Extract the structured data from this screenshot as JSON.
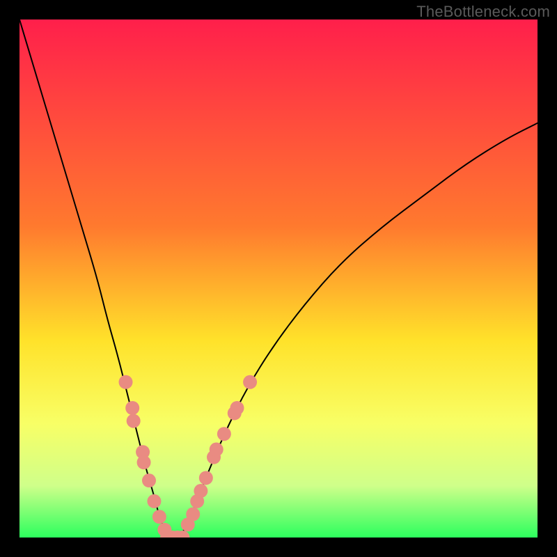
{
  "watermark": {
    "text": "TheBottleneck.com"
  },
  "chart_data": {
    "type": "line",
    "title": "",
    "xlabel": "",
    "ylabel": "",
    "xlim": [
      0,
      100
    ],
    "ylim": [
      0,
      100
    ],
    "grid": false,
    "legend": false,
    "background_gradient": {
      "stops": [
        {
          "offset": 0,
          "color": "#ff1f4b"
        },
        {
          "offset": 40,
          "color": "#ff7a2e"
        },
        {
          "offset": 62,
          "color": "#ffe22a"
        },
        {
          "offset": 78,
          "color": "#f8ff66"
        },
        {
          "offset": 90,
          "color": "#cfff8a"
        },
        {
          "offset": 100,
          "color": "#2cff5e"
        }
      ]
    },
    "series": [
      {
        "name": "left-curve",
        "x": [
          0,
          3,
          6,
          9,
          12,
          15,
          17,
          19,
          21,
          23,
          24.5,
          26,
          27,
          28,
          28.5
        ],
        "y": [
          100,
          90,
          80,
          70,
          60,
          50,
          42,
          35,
          27,
          19,
          13,
          8,
          4,
          1.5,
          0
        ],
        "color": "#000000",
        "stroke_width": 2
      },
      {
        "name": "right-curve",
        "x": [
          31,
          32,
          33.5,
          35,
          37,
          40,
          44,
          49,
          55,
          62,
          70,
          78,
          86,
          94,
          100
        ],
        "y": [
          0,
          2,
          5,
          9,
          14,
          21,
          29,
          37,
          45,
          53,
          60,
          66,
          72,
          77,
          80
        ],
        "color": "#000000",
        "stroke_width": 2
      }
    ],
    "marker_groups": [
      {
        "name": "left-markers",
        "color": "#e98b82",
        "radius": 10,
        "points": [
          {
            "x": 20.5,
            "y": 30
          },
          {
            "x": 21.8,
            "y": 25
          },
          {
            "x": 22.0,
            "y": 22.5
          },
          {
            "x": 23.8,
            "y": 16.5
          },
          {
            "x": 24.0,
            "y": 14.5
          },
          {
            "x": 25.0,
            "y": 11
          },
          {
            "x": 26.0,
            "y": 7
          },
          {
            "x": 27.0,
            "y": 4
          },
          {
            "x": 28.0,
            "y": 1.5
          }
        ]
      },
      {
        "name": "bottom-markers",
        "color": "#e98b82",
        "radius": 10,
        "points": [
          {
            "x": 28.5,
            "y": 0
          },
          {
            "x": 29.5,
            "y": 0
          },
          {
            "x": 30.5,
            "y": 0
          },
          {
            "x": 31.5,
            "y": 0
          }
        ]
      },
      {
        "name": "right-markers",
        "color": "#e98b82",
        "radius": 10,
        "points": [
          {
            "x": 32.5,
            "y": 2.5
          },
          {
            "x": 33.5,
            "y": 4.5
          },
          {
            "x": 34.3,
            "y": 7
          },
          {
            "x": 35.0,
            "y": 9
          },
          {
            "x": 36.0,
            "y": 11.5
          },
          {
            "x": 37.5,
            "y": 15.5
          },
          {
            "x": 38.0,
            "y": 17
          },
          {
            "x": 39.5,
            "y": 20
          },
          {
            "x": 41.5,
            "y": 24
          },
          {
            "x": 42.0,
            "y": 25
          },
          {
            "x": 44.5,
            "y": 30
          }
        ]
      }
    ]
  }
}
